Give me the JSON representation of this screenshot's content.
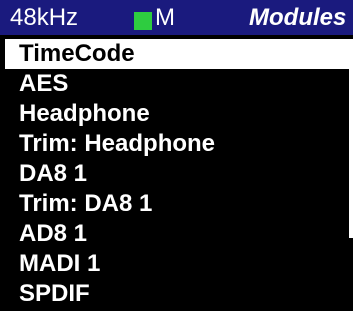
{
  "status_bar": {
    "sample_rate": "48kHz",
    "mode": "M",
    "title": "Modules",
    "indicator_color": "#2ecc40",
    "background_color": "#1a1a7e"
  },
  "menu": {
    "selected_index": 0,
    "items": [
      {
        "label": "TimeCode"
      },
      {
        "label": "AES"
      },
      {
        "label": "Headphone"
      },
      {
        "label": "Trim: Headphone"
      },
      {
        "label": "DA8 1"
      },
      {
        "label": "Trim: DA8 1"
      },
      {
        "label": "AD8 1"
      },
      {
        "label": "MADI 1"
      },
      {
        "label": "SPDIF"
      }
    ]
  }
}
